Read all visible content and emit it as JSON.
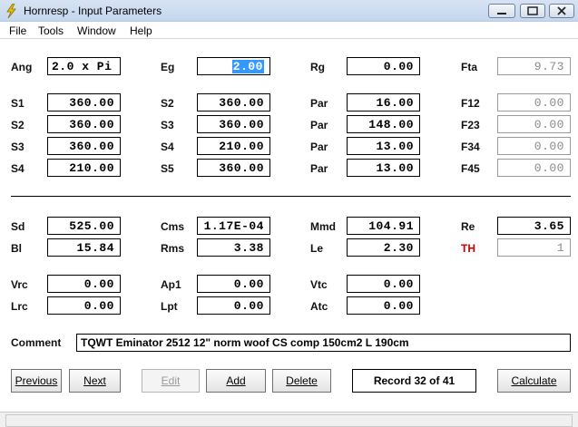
{
  "window": {
    "title": "Hornresp - Input Parameters",
    "accent": "#c4d6ee"
  },
  "menu": [
    "File",
    "Tools",
    "Window",
    "Help"
  ],
  "horn": {
    "row1": [
      {
        "label": "Ang",
        "value": "2.0 x Pi"
      },
      {
        "label": "Eg",
        "value": "2.00"
      },
      {
        "label": "Rg",
        "value": "0.00"
      },
      {
        "label": "Fta",
        "value": "9.73"
      }
    ],
    "rows": [
      [
        {
          "label": "S1",
          "value": "360.00"
        },
        {
          "label": "S2",
          "value": "360.00"
        },
        {
          "label": "Par",
          "value": "16.00"
        },
        {
          "label": "F12",
          "value": "0.00"
        }
      ],
      [
        {
          "label": "S2",
          "value": "360.00"
        },
        {
          "label": "S3",
          "value": "360.00"
        },
        {
          "label": "Par",
          "value": "148.00"
        },
        {
          "label": "F23",
          "value": "0.00"
        }
      ],
      [
        {
          "label": "S3",
          "value": "360.00"
        },
        {
          "label": "S4",
          "value": "210.00"
        },
        {
          "label": "Par",
          "value": "13.00"
        },
        {
          "label": "F34",
          "value": "0.00"
        }
      ],
      [
        {
          "label": "S4",
          "value": "210.00"
        },
        {
          "label": "S5",
          "value": "360.00"
        },
        {
          "label": "Par",
          "value": "13.00"
        },
        {
          "label": "F45",
          "value": "0.00"
        }
      ]
    ]
  },
  "driver": {
    "rows": [
      [
        {
          "label": "Sd",
          "value": "525.00"
        },
        {
          "label": "Cms",
          "value": "1.17E-04"
        },
        {
          "label": "Mmd",
          "value": "104.91"
        },
        {
          "label": "Re",
          "value": "3.65"
        }
      ],
      [
        {
          "label": "Bl",
          "value": "15.84"
        },
        {
          "label": "Rms",
          "value": "3.38"
        },
        {
          "label": "Le",
          "value": "2.30"
        },
        {
          "label": "TH",
          "value": "1"
        }
      ]
    ]
  },
  "chambers": {
    "rows": [
      [
        {
          "label": "Vrc",
          "value": "0.00"
        },
        {
          "label": "Ap1",
          "value": "0.00"
        },
        {
          "label": "Vtc",
          "value": "0.00"
        }
      ],
      [
        {
          "label": "Lrc",
          "value": "0.00"
        },
        {
          "label": "Lpt",
          "value": "0.00"
        },
        {
          "label": "Atc",
          "value": "0.00"
        }
      ]
    ]
  },
  "comment": {
    "label": "Comment",
    "value": "TQWT Eminator 2512 12\" norm woof CS comp 150cm2  L 190cm"
  },
  "buttons": {
    "previous": "Previous",
    "next": "Next",
    "edit": "Edit",
    "add": "Add",
    "delete": "Delete",
    "calculate": "Calculate"
  },
  "record": "Record 32 of 41",
  "colors": {
    "selection": "#3399ff",
    "th_label": "#cc0000"
  }
}
